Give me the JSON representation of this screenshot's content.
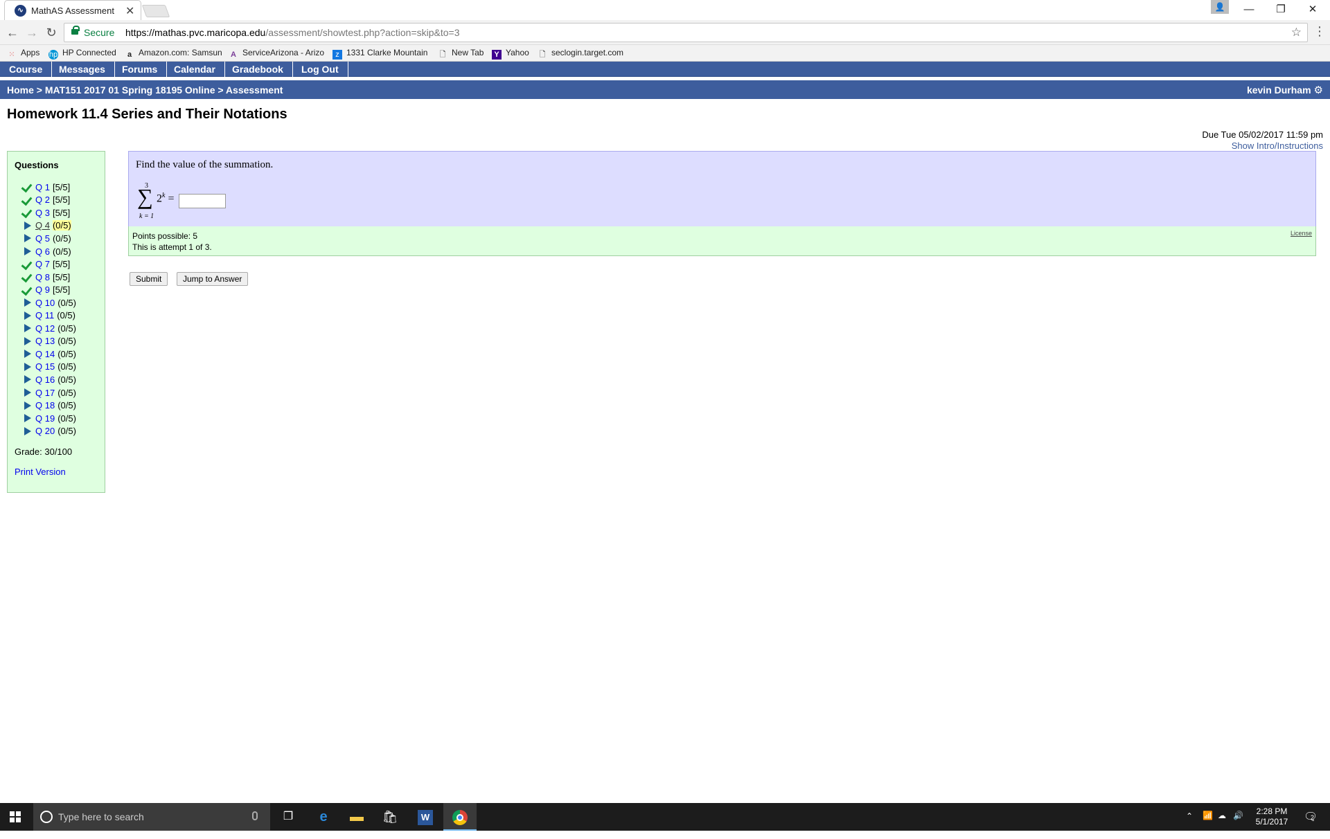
{
  "browser": {
    "tab_title": "MathAS Assessment",
    "tab_close": "✕",
    "secure_label": "Secure",
    "url_host": "https://mathas.pvc.maricopa.edu",
    "url_path": "/assessment/showtest.php?action=skip&to=3",
    "window_controls": {
      "minimize": "—",
      "restore": "❐",
      "close": "✕"
    },
    "bookmarks": [
      {
        "label": "Apps",
        "icon": "apps-grid-icon"
      },
      {
        "label": "HP Connected",
        "icon": "hp-icon"
      },
      {
        "label": "Amazon.com: Samsun",
        "icon": "amazon-icon"
      },
      {
        "label": "ServiceArizona - Arizo",
        "icon": "servicearizona-icon"
      },
      {
        "label": "1331 Clarke Mountain",
        "icon": "zillow-icon"
      },
      {
        "label": "New Tab",
        "icon": "page-icon"
      },
      {
        "label": "Yahoo",
        "icon": "yahoo-icon"
      },
      {
        "label": "seclogin.target.com",
        "icon": "page-icon"
      }
    ]
  },
  "nav": {
    "links": [
      "Course",
      "Messages",
      "Forums",
      "Calendar",
      "Gradebook",
      "Log Out"
    ],
    "breadcrumb": "Home > MAT151 2017 01 Spring 18195 Online > Assessment",
    "user": "kevin Durham"
  },
  "page": {
    "title": "Homework 11.4 Series and Their Notations",
    "due": "Due Tue 05/02/2017 11:59 pm",
    "intro_link": "Show Intro/Instructions"
  },
  "questions_panel": {
    "title": "Questions",
    "items": [
      {
        "label": "Q 1",
        "score": "[5/5]",
        "status": "done"
      },
      {
        "label": "Q 2",
        "score": "[5/5]",
        "status": "done"
      },
      {
        "label": "Q 3",
        "score": "[5/5]",
        "status": "done"
      },
      {
        "label": "Q 4",
        "score": "(0/5)",
        "status": "current"
      },
      {
        "label": "Q 5",
        "score": "(0/5)",
        "status": "todo"
      },
      {
        "label": "Q 6",
        "score": "(0/5)",
        "status": "todo"
      },
      {
        "label": "Q 7",
        "score": "[5/5]",
        "status": "done"
      },
      {
        "label": "Q 8",
        "score": "[5/5]",
        "status": "done"
      },
      {
        "label": "Q 9",
        "score": "[5/5]",
        "status": "done"
      },
      {
        "label": "Q 10",
        "score": "(0/5)",
        "status": "todo"
      },
      {
        "label": "Q 11",
        "score": "(0/5)",
        "status": "todo"
      },
      {
        "label": "Q 12",
        "score": "(0/5)",
        "status": "todo"
      },
      {
        "label": "Q 13",
        "score": "(0/5)",
        "status": "todo"
      },
      {
        "label": "Q 14",
        "score": "(0/5)",
        "status": "todo"
      },
      {
        "label": "Q 15",
        "score": "(0/5)",
        "status": "todo"
      },
      {
        "label": "Q 16",
        "score": "(0/5)",
        "status": "todo"
      },
      {
        "label": "Q 17",
        "score": "(0/5)",
        "status": "todo"
      },
      {
        "label": "Q 18",
        "score": "(0/5)",
        "status": "todo"
      },
      {
        "label": "Q 19",
        "score": "(0/5)",
        "status": "todo"
      },
      {
        "label": "Q 20",
        "score": "(0/5)",
        "status": "todo"
      }
    ],
    "grade": "Grade: 30/100",
    "print_link": "Print Version"
  },
  "question": {
    "prompt": "Find the value of the summation.",
    "sum_upper": "3",
    "sum_lower": "k = 1",
    "sum_base": "2",
    "sum_exponent": "k",
    "equals": "=",
    "answer_value": "",
    "points": "Points possible: 5",
    "attempt": "This is attempt 1 of 3.",
    "license": "License"
  },
  "buttons": {
    "submit": "Submit",
    "jump": "Jump to Answer"
  },
  "taskbar": {
    "search_placeholder": "Type here to search",
    "time": "2:28 PM",
    "date": "5/1/2017",
    "notification_count": "2"
  },
  "colors": {
    "nav_bg": "#3d5d9d",
    "question_bg": "#ddddff",
    "panel_bg": "#dfffe0",
    "check": "#1a9a38"
  }
}
